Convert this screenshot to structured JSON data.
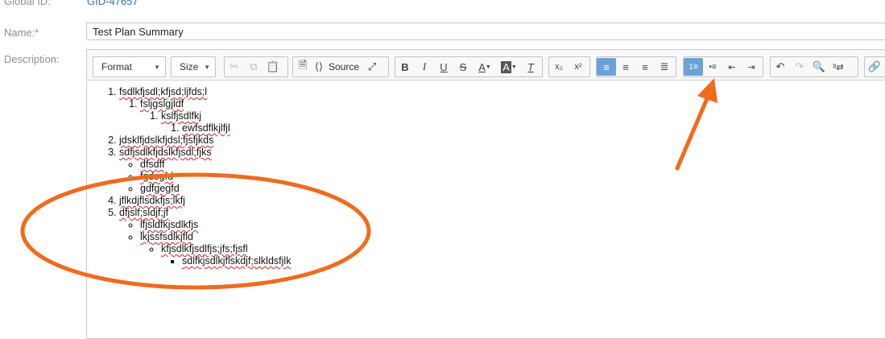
{
  "form": {
    "global_id_label": "Global ID:",
    "global_id_value": "GID-47657",
    "name_label": "Name:*",
    "name_value": "Test Plan Summary",
    "description_label": "Description:"
  },
  "toolbar": {
    "format_label": "Format",
    "size_label": "Size",
    "source_label": "Source",
    "bold": "B",
    "italic": "I",
    "underline": "U",
    "strike": "S",
    "text_color": "A",
    "bg_color": "A",
    "remove_format": "T",
    "subscript": "x₂",
    "superscript": "x²",
    "icons": [
      "cut-icon",
      "copy-icon",
      "paste-icon",
      "templates-icon",
      "source-icon",
      "maximize-icon",
      "align-left-icon",
      "align-center-icon",
      "align-right-icon",
      "justify-icon",
      "numbered-list-icon",
      "bulleted-list-icon",
      "outdent-icon",
      "indent-icon",
      "undo-icon",
      "redo-icon",
      "find-icon",
      "replace-icon",
      "link-icon"
    ],
    "active_color": "#6aa2d8"
  },
  "content": {
    "items": [
      "fsdlkfjsdl;kfjsd;ljfds;l",
      "fsljgslgjldf",
      "kslfjsdlfkj",
      "ewfsdflkjlfjl",
      "jdsklfjdslkfjdsl;fjsfjkds",
      "sdfjsdlkfjdslkfjsdl;fjks",
      "dfsdff",
      "fgdsgfd",
      "gdfgegfd",
      "jflkdjflsdkfjs;lkfj",
      "dfjslf;sldjf;jf",
      "lfjsldfkjsdlkfjs",
      "lkjssfsdlkjfld",
      "kfjsdlkfjsdlfjs;jfs;fjsfl",
      "sdlfkjsdlkjflskdjf;slkldsfjlk"
    ]
  },
  "annotation": {
    "color": "#f26a1b"
  }
}
